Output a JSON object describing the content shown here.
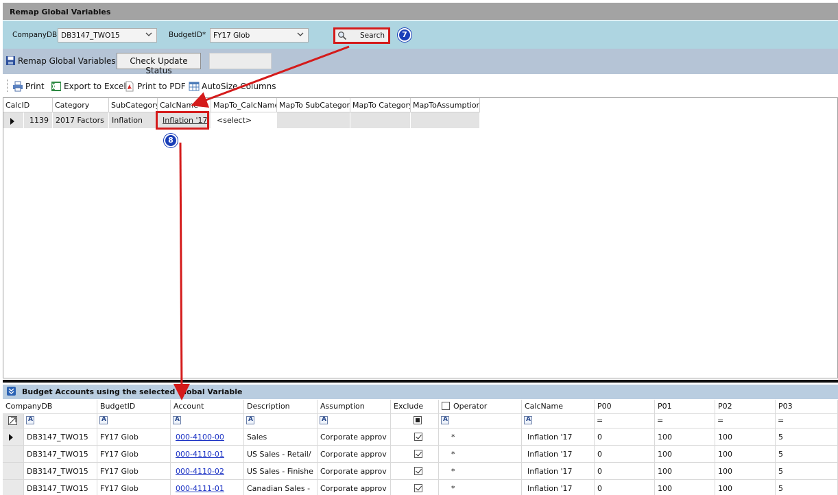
{
  "window": {
    "title": "Remap Global Variables"
  },
  "filters": {
    "company_label": "CompanyDB",
    "company_value": "DB3147_TWO15",
    "budget_label": "BudgetID*",
    "budget_value": "FY17 Glob",
    "search_label": "Search"
  },
  "callouts": {
    "step7": "7",
    "step8": "8"
  },
  "actions": {
    "remap_label": "Remap Global Variables",
    "check_status_label": "Check Update Status",
    "blank_value": ""
  },
  "toolbar": {
    "print": "Print",
    "export_excel": "Export to Excel",
    "print_pdf": "Print to PDF",
    "autosize": "AutoSize Columns"
  },
  "grid1": {
    "columns": [
      "CalcID",
      "Category",
      "SubCategory",
      "CalcName",
      "MapTo_CalcName",
      "MapTo SubCategory",
      "MapTo Category",
      "MapToAssumption"
    ],
    "row": {
      "calcid": "1139",
      "category": "2017 Factors",
      "subcategory": "Inflation",
      "calcname": "Inflation '17",
      "mapto_calcname": "<select>",
      "mapto_subcategory": "",
      "mapto_category": "",
      "mapto_assumption": ""
    }
  },
  "panel": {
    "title": "Budget Accounts using the selected Global Variable",
    "columns": [
      "CompanyDB",
      "BudgetID",
      "Account",
      "Description",
      "Assumption",
      "Exclude",
      "Operator",
      "CalcName",
      "P00",
      "P01",
      "P02",
      "P03"
    ],
    "filter_ops": {
      "p00": "=",
      "p01": "=",
      "p02": "=",
      "p03": "="
    },
    "rows": [
      {
        "company": "DB3147_TWO15",
        "budget": "FY17 Glob",
        "account": "000-4100-00",
        "description": "Sales",
        "assumption": "Corporate approv",
        "exclude": true,
        "operator": "*",
        "calcname": "Inflation '17",
        "p00": "0",
        "p01": "100",
        "p02": "100",
        "p03": "5"
      },
      {
        "company": "DB3147_TWO15",
        "budget": "FY17 Glob",
        "account": "000-4110-01",
        "description": "US Sales - Retail/",
        "assumption": "Corporate approv",
        "exclude": true,
        "operator": "*",
        "calcname": "Inflation '17",
        "p00": "0",
        "p01": "100",
        "p02": "100",
        "p03": "5"
      },
      {
        "company": "DB3147_TWO15",
        "budget": "FY17 Glob",
        "account": "000-4110-02",
        "description": "US Sales - Finishe",
        "assumption": "Corporate approv",
        "exclude": true,
        "operator": "*",
        "calcname": "Inflation '17",
        "p00": "0",
        "p01": "100",
        "p02": "100",
        "p03": "5"
      },
      {
        "company": "DB3147_TWO15",
        "budget": "FY17 Glob",
        "account": "000-4111-01",
        "description": "Canadian Sales -",
        "assumption": "Corporate approv",
        "exclude": true,
        "operator": "*",
        "calcname": "Inflation '17",
        "p00": "0",
        "p01": "100",
        "p02": "100",
        "p03": "5"
      }
    ]
  },
  "colors": {
    "accent_red": "#d41b1b",
    "badge_blue": "#1a3fb8",
    "link_blue": "#1b32c4"
  }
}
